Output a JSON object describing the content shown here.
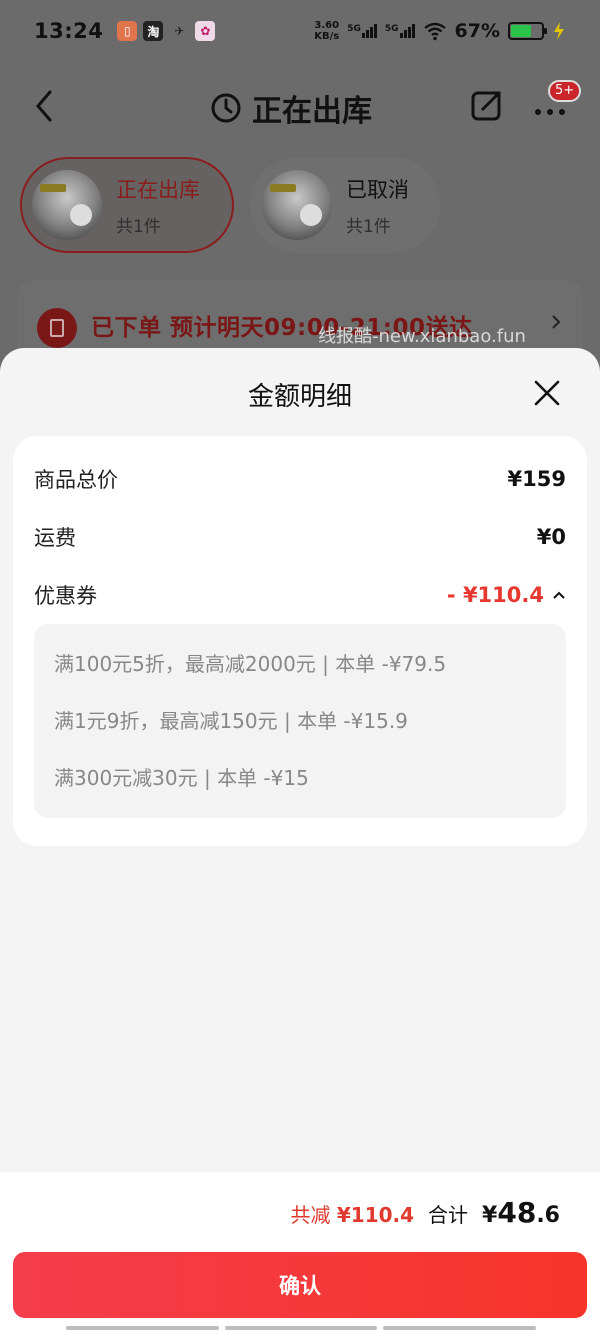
{
  "status_bar": {
    "time": "13:24",
    "net_speed_value": "3.60",
    "net_speed_unit": "KB/s",
    "sim1": "5G",
    "sim2": "5G",
    "battery_pct": "67%",
    "battery_level": 0.67,
    "app_icons": [
      "notification-app-icon",
      "taobao-icon",
      "bird-app-icon",
      "flower-app-icon"
    ],
    "app_icon_labels": [
      "淘"
    ]
  },
  "header": {
    "title": "正在出库",
    "badge": "5+"
  },
  "status_tabs": [
    {
      "label": "正在出库",
      "count": "共1件",
      "active": true
    },
    {
      "label": "已取消",
      "count": "共1件",
      "active": false
    }
  ],
  "order_status": {
    "text": "已下单 预计明天09:00-21:00送达"
  },
  "watermark": "线报酷-new.xianbao.fun",
  "sheet": {
    "title": "金额明细",
    "rows": [
      {
        "label": "商品总价",
        "value": "¥159"
      },
      {
        "label": "运费",
        "value": "¥0"
      }
    ],
    "coupon": {
      "label": "优惠券",
      "value": "- ¥110.4",
      "items": [
        "满100元5折，最高减2000元 | 本单 -¥79.5",
        "满1元9折，最高减150元 | 本单 -¥15.9",
        "满300元减30元 | 本单 -¥15"
      ]
    }
  },
  "footer": {
    "saved_label": "共减",
    "saved_amount": "¥110.4",
    "total_label": "合计",
    "total_currency": "¥",
    "total_int": "48",
    "total_dec": ".6",
    "confirm_label": "确认"
  },
  "colors": {
    "accent": "#e8372f",
    "button": "#f43d4b",
    "battery": "#2cc34a"
  }
}
